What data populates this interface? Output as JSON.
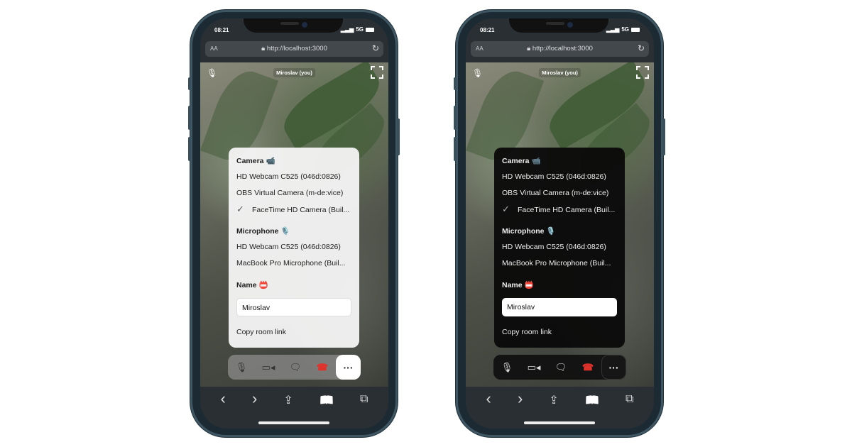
{
  "phones": [
    {
      "theme": "light"
    },
    {
      "theme": "dark"
    }
  ],
  "status": {
    "time": "08:21",
    "network": "5G",
    "signal_icon": "signal-bars-icon",
    "battery_icon": "battery-icon"
  },
  "browser": {
    "text_size_label": "AA",
    "url": "http://localhost:3000",
    "lock_icon": "lock-icon",
    "reload_icon": "reload-icon"
  },
  "video": {
    "participant_label": "Miroslav (you)"
  },
  "menu": {
    "camera_heading": "Camera 📹",
    "cameras": [
      "HD Webcam C525 (046d:0826)",
      "OBS Virtual Camera (m-de:vice)",
      "FaceTime HD Camera (Buil..."
    ],
    "selected_camera_index": 2,
    "check_mark": "✓",
    "microphone_heading": "Microphone 🎙️",
    "microphones": [
      "HD Webcam C525 (046d:0826)",
      "MacBook Pro Microphone (Buil..."
    ],
    "name_heading": "Name 📛",
    "name_value": "Miroslav",
    "copy_link_label": "Copy room link"
  },
  "controls": {
    "more_label": "···",
    "hangup_color": "#e0312b"
  },
  "toolbar": {
    "back": "‹",
    "forward": "›",
    "share": "⇪",
    "bookmarks": "📖",
    "tabs": "⧉"
  }
}
